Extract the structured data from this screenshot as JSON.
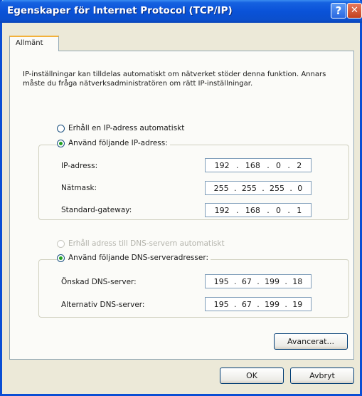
{
  "window": {
    "title": "Egenskaper för Internet Protocol (TCP/IP)"
  },
  "titlebar_buttons": {
    "help": "?",
    "close": "✕"
  },
  "tabs": [
    {
      "label": "Allmänt"
    }
  ],
  "description": "IP-inställningar kan tilldelas automatiskt om nätverket stöder denna funktion. Annars måste du fråga nätverksadministratören om rätt IP-inställningar.",
  "ip_section": {
    "auto_option": "Erhåll en IP-adress automatiskt",
    "manual_option": "Använd följande IP-adress:",
    "selected": "manual",
    "fields": [
      {
        "label": "IP-adress:",
        "octets": [
          "192",
          "168",
          "0",
          "2"
        ]
      },
      {
        "label": "Nätmask:",
        "octets": [
          "255",
          "255",
          "255",
          "0"
        ]
      },
      {
        "label": "Standard-gateway:",
        "octets": [
          "192",
          "168",
          "0",
          "1"
        ]
      }
    ]
  },
  "dns_section": {
    "auto_option": "Erhåll adress till DNS-servern automatiskt",
    "auto_enabled": false,
    "manual_option": "Använd följande DNS-serveradresser:",
    "selected": "manual",
    "fields": [
      {
        "label": "Önskad DNS-server:",
        "octets": [
          "195",
          "67",
          "199",
          "18"
        ]
      },
      {
        "label": "Alternativ DNS-server:",
        "octets": [
          "195",
          "67",
          "199",
          "19"
        ]
      }
    ]
  },
  "buttons": {
    "advanced": "Avancerat...",
    "ok": "OK",
    "cancel": "Avbryt"
  },
  "colors": {
    "titlebar": "#0a52d8",
    "dialog_bg": "#ece9d8",
    "radio_dot": "#21a121"
  }
}
